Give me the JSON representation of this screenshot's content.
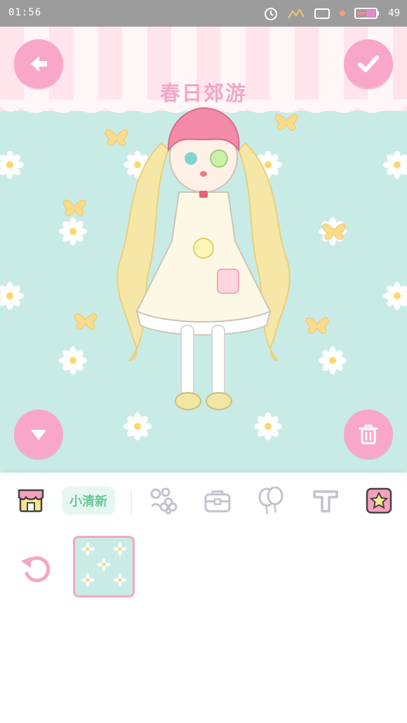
{
  "status_bar": {
    "time": "01:56",
    "battery_level": "49",
    "icons": [
      "alarm-icon",
      "signal-icon",
      "screen-icon",
      "notification-icon",
      "battery-icon"
    ]
  },
  "header": {
    "title": "春日郊游",
    "back_icon": "arrow-left-icon",
    "confirm_icon": "checkmark-icon"
  },
  "scene": {
    "background_color": "#c9ebe6",
    "curtain_colors": [
      "#ffe4ec",
      "#fff6f8"
    ],
    "collapse_icon": "triangle-down-icon",
    "delete_icon": "trash-icon"
  },
  "panel": {
    "tabs": [
      {
        "icon": "shop-icon"
      },
      {
        "label": "小清新"
      },
      {
        "icon": "flower-accessory-icon"
      },
      {
        "icon": "bag-icon"
      },
      {
        "icon": "balloon-icon"
      },
      {
        "icon": "text-icon"
      },
      {
        "icon": "star-badge-icon"
      }
    ],
    "undo_icon": "undo-icon",
    "items": [
      {
        "name": "daisy-pattern-background",
        "selected": true
      }
    ]
  },
  "colors": {
    "accent_pink": "#f9a7c8",
    "fresh_green": "#6cc79a",
    "icon_gray": "#c4c2d0"
  }
}
